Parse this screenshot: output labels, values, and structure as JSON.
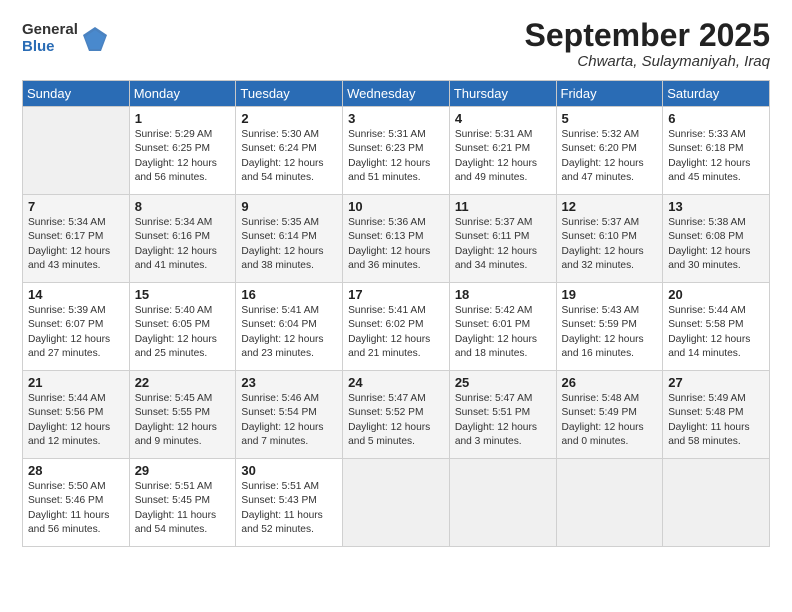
{
  "logo": {
    "general": "General",
    "blue": "Blue"
  },
  "header": {
    "month": "September 2025",
    "location": "Chwarta, Sulaymaniyah, Iraq"
  },
  "weekdays": [
    "Sunday",
    "Monday",
    "Tuesday",
    "Wednesday",
    "Thursday",
    "Friday",
    "Saturday"
  ],
  "weeks": [
    [
      {
        "date": "",
        "info": ""
      },
      {
        "date": "1",
        "info": "Sunrise: 5:29 AM\nSunset: 6:25 PM\nDaylight: 12 hours\nand 56 minutes."
      },
      {
        "date": "2",
        "info": "Sunrise: 5:30 AM\nSunset: 6:24 PM\nDaylight: 12 hours\nand 54 minutes."
      },
      {
        "date": "3",
        "info": "Sunrise: 5:31 AM\nSunset: 6:23 PM\nDaylight: 12 hours\nand 51 minutes."
      },
      {
        "date": "4",
        "info": "Sunrise: 5:31 AM\nSunset: 6:21 PM\nDaylight: 12 hours\nand 49 minutes."
      },
      {
        "date": "5",
        "info": "Sunrise: 5:32 AM\nSunset: 6:20 PM\nDaylight: 12 hours\nand 47 minutes."
      },
      {
        "date": "6",
        "info": "Sunrise: 5:33 AM\nSunset: 6:18 PM\nDaylight: 12 hours\nand 45 minutes."
      }
    ],
    [
      {
        "date": "7",
        "info": "Sunrise: 5:34 AM\nSunset: 6:17 PM\nDaylight: 12 hours\nand 43 minutes."
      },
      {
        "date": "8",
        "info": "Sunrise: 5:34 AM\nSunset: 6:16 PM\nDaylight: 12 hours\nand 41 minutes."
      },
      {
        "date": "9",
        "info": "Sunrise: 5:35 AM\nSunset: 6:14 PM\nDaylight: 12 hours\nand 38 minutes."
      },
      {
        "date": "10",
        "info": "Sunrise: 5:36 AM\nSunset: 6:13 PM\nDaylight: 12 hours\nand 36 minutes."
      },
      {
        "date": "11",
        "info": "Sunrise: 5:37 AM\nSunset: 6:11 PM\nDaylight: 12 hours\nand 34 minutes."
      },
      {
        "date": "12",
        "info": "Sunrise: 5:37 AM\nSunset: 6:10 PM\nDaylight: 12 hours\nand 32 minutes."
      },
      {
        "date": "13",
        "info": "Sunrise: 5:38 AM\nSunset: 6:08 PM\nDaylight: 12 hours\nand 30 minutes."
      }
    ],
    [
      {
        "date": "14",
        "info": "Sunrise: 5:39 AM\nSunset: 6:07 PM\nDaylight: 12 hours\nand 27 minutes."
      },
      {
        "date": "15",
        "info": "Sunrise: 5:40 AM\nSunset: 6:05 PM\nDaylight: 12 hours\nand 25 minutes."
      },
      {
        "date": "16",
        "info": "Sunrise: 5:41 AM\nSunset: 6:04 PM\nDaylight: 12 hours\nand 23 minutes."
      },
      {
        "date": "17",
        "info": "Sunrise: 5:41 AM\nSunset: 6:02 PM\nDaylight: 12 hours\nand 21 minutes."
      },
      {
        "date": "18",
        "info": "Sunrise: 5:42 AM\nSunset: 6:01 PM\nDaylight: 12 hours\nand 18 minutes."
      },
      {
        "date": "19",
        "info": "Sunrise: 5:43 AM\nSunset: 5:59 PM\nDaylight: 12 hours\nand 16 minutes."
      },
      {
        "date": "20",
        "info": "Sunrise: 5:44 AM\nSunset: 5:58 PM\nDaylight: 12 hours\nand 14 minutes."
      }
    ],
    [
      {
        "date": "21",
        "info": "Sunrise: 5:44 AM\nSunset: 5:56 PM\nDaylight: 12 hours\nand 12 minutes."
      },
      {
        "date": "22",
        "info": "Sunrise: 5:45 AM\nSunset: 5:55 PM\nDaylight: 12 hours\nand 9 minutes."
      },
      {
        "date": "23",
        "info": "Sunrise: 5:46 AM\nSunset: 5:54 PM\nDaylight: 12 hours\nand 7 minutes."
      },
      {
        "date": "24",
        "info": "Sunrise: 5:47 AM\nSunset: 5:52 PM\nDaylight: 12 hours\nand 5 minutes."
      },
      {
        "date": "25",
        "info": "Sunrise: 5:47 AM\nSunset: 5:51 PM\nDaylight: 12 hours\nand 3 minutes."
      },
      {
        "date": "26",
        "info": "Sunrise: 5:48 AM\nSunset: 5:49 PM\nDaylight: 12 hours\nand 0 minutes."
      },
      {
        "date": "27",
        "info": "Sunrise: 5:49 AM\nSunset: 5:48 PM\nDaylight: 11 hours\nand 58 minutes."
      }
    ],
    [
      {
        "date": "28",
        "info": "Sunrise: 5:50 AM\nSunset: 5:46 PM\nDaylight: 11 hours\nand 56 minutes."
      },
      {
        "date": "29",
        "info": "Sunrise: 5:51 AM\nSunset: 5:45 PM\nDaylight: 11 hours\nand 54 minutes."
      },
      {
        "date": "30",
        "info": "Sunrise: 5:51 AM\nSunset: 5:43 PM\nDaylight: 11 hours\nand 52 minutes."
      },
      {
        "date": "",
        "info": ""
      },
      {
        "date": "",
        "info": ""
      },
      {
        "date": "",
        "info": ""
      },
      {
        "date": "",
        "info": ""
      }
    ]
  ]
}
